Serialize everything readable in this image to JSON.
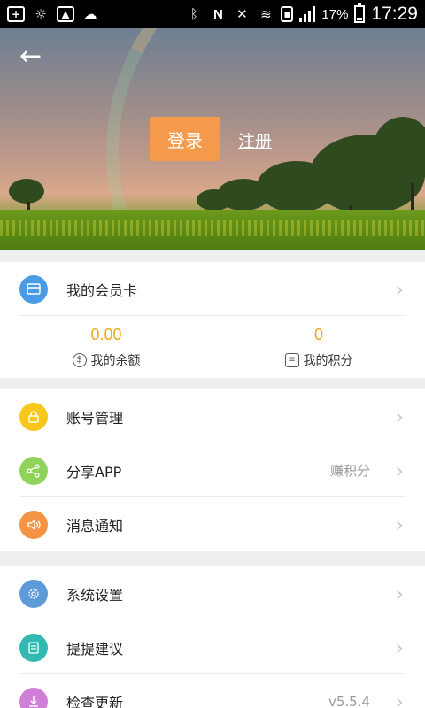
{
  "status_bar": {
    "battery_text": "17%",
    "time": "17:29",
    "icons": [
      "add-icon",
      "weather-icon",
      "image-icon",
      "cloud-icon",
      "bluetooth-icon",
      "nfc-icon",
      "mute-icon",
      "wifi-icon",
      "sim-icon",
      "signal-icon",
      "battery-icon"
    ]
  },
  "header": {
    "login_label": "登录",
    "register_label": "注册",
    "login_color": "#f59a4a"
  },
  "membership": {
    "card_label": "我的会员卡",
    "balance_value": "0.00",
    "balance_label": "我的余额",
    "points_value": "0",
    "points_label": "我的积分",
    "value_color": "#f0a81d"
  },
  "menu_group_1": [
    {
      "label": "账号管理",
      "hint": "",
      "icon": "lock-icon",
      "color": "#f7c71b"
    },
    {
      "label": "分享APP",
      "hint": "赚积分",
      "icon": "share-icon",
      "color": "#8fd35a"
    },
    {
      "label": "消息通知",
      "hint": "",
      "icon": "speaker-icon",
      "color": "#f49444"
    }
  ],
  "menu_group_2": [
    {
      "label": "系统设置",
      "hint": "",
      "icon": "gear-icon",
      "color": "#5c9bd8"
    },
    {
      "label": "提提建议",
      "hint": "",
      "icon": "feedback-icon",
      "color": "#32b9b1"
    },
    {
      "label": "检查更新",
      "hint": "v5.5.4",
      "icon": "download-icon",
      "color": "#cf7fd8"
    }
  ]
}
